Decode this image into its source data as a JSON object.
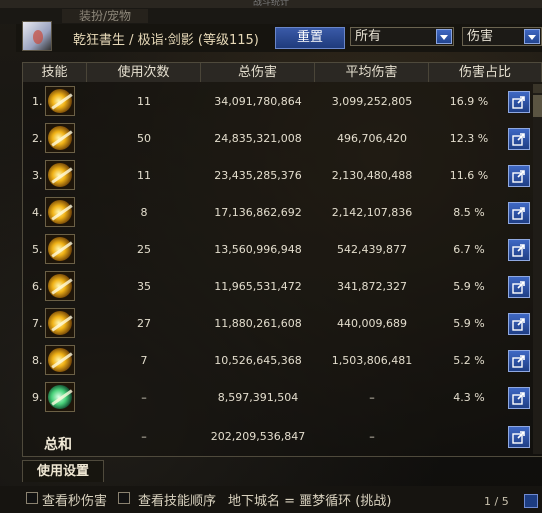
{
  "window": {
    "title": "战斗统计"
  },
  "top_tab": {
    "label": "装扮/宠物"
  },
  "header": {
    "character": "乾狂書生 / 极诣·剑影 (等级115)",
    "reset_label": "重置",
    "filter_target": "所有",
    "filter_metric": "伤害"
  },
  "columns": [
    "技能",
    "使用次数",
    "总伤害",
    "平均伤害",
    "伤害占比"
  ],
  "rows": [
    {
      "index": "1.",
      "count": "11",
      "total": "34,091,780,864",
      "avg": "3,099,252,805",
      "pct": "16.9  %"
    },
    {
      "index": "2.",
      "count": "50",
      "total": "24,835,321,008",
      "avg": "496,706,420",
      "pct": "12.3  %"
    },
    {
      "index": "3.",
      "count": "11",
      "total": "23,435,285,376",
      "avg": "2,130,480,488",
      "pct": "11.6  %"
    },
    {
      "index": "4.",
      "count": "8",
      "total": "17,136,862,692",
      "avg": "2,142,107,836",
      "pct": "8.5  %"
    },
    {
      "index": "5.",
      "count": "25",
      "total": "13,560,996,948",
      "avg": "542,439,877",
      "pct": "6.7  %"
    },
    {
      "index": "6.",
      "count": "35",
      "total": "11,965,531,472",
      "avg": "341,872,327",
      "pct": "5.9  %"
    },
    {
      "index": "7.",
      "count": "27",
      "total": "11,880,261,608",
      "avg": "440,009,689",
      "pct": "5.9  %"
    },
    {
      "index": "8.",
      "count": "7",
      "total": "10,526,645,368",
      "avg": "1,503,806,481",
      "pct": "5.2  %"
    },
    {
      "index": "9.",
      "count": "–",
      "total": "8,597,391,504",
      "avg": "–",
      "pct": "4.3  %"
    }
  ],
  "summary": {
    "label": "总和",
    "count": "–",
    "total": "202,209,536,847",
    "avg": "–"
  },
  "usage_tab": "使用设置",
  "footer": {
    "check_dps": "查看秒伤害",
    "check_order": "查看技能顺序",
    "dungeon": "地下城名 = 噩梦循环 (挑战)",
    "page": "1 / 5"
  }
}
